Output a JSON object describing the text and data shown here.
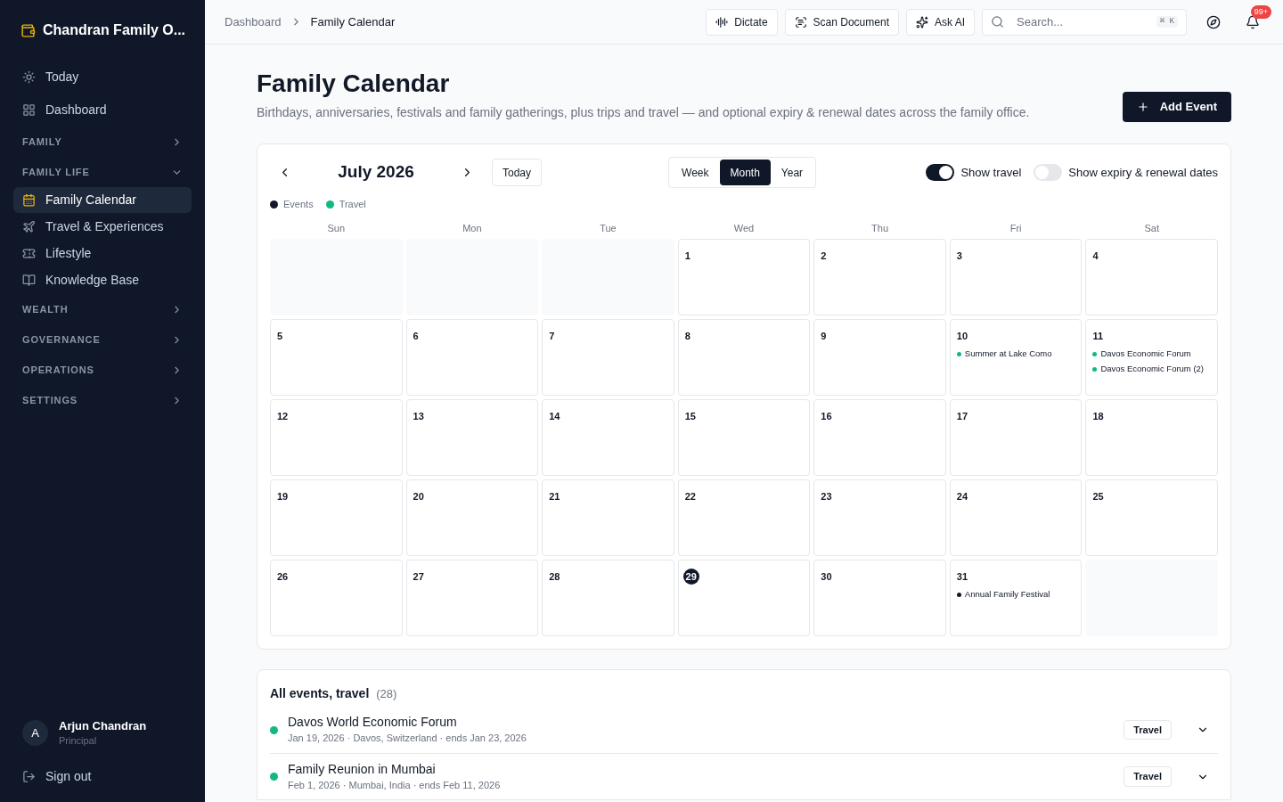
{
  "sidebar": {
    "brand": "Chandran Family O...",
    "items": [
      {
        "kind": "link",
        "label": "Today",
        "selected": false
      },
      {
        "kind": "link",
        "label": "Dashboard",
        "selected": false
      },
      {
        "kind": "section",
        "label": "FAMILY",
        "expanded": false
      },
      {
        "kind": "section",
        "label": "FAMILY LIFE",
        "expanded": true
      },
      {
        "kind": "link",
        "label": "Family Calendar",
        "selected": true
      },
      {
        "kind": "link",
        "label": "Travel & Experiences",
        "selected": false
      },
      {
        "kind": "link",
        "label": "Lifestyle",
        "selected": false
      },
      {
        "kind": "link",
        "label": "Knowledge Base",
        "selected": false
      },
      {
        "kind": "section",
        "label": "WEALTH",
        "expanded": false
      },
      {
        "kind": "section",
        "label": "GOVERNANCE",
        "expanded": false
      },
      {
        "kind": "section",
        "label": "OPERATIONS",
        "expanded": false
      },
      {
        "kind": "section",
        "label": "SETTINGS",
        "expanded": false
      }
    ],
    "user": {
      "initial": "A",
      "name": "Arjun Chandran",
      "role": "Principal"
    },
    "sign_out": "Sign out"
  },
  "topbar": {
    "breadcrumb": [
      "Dashboard",
      "Family Calendar"
    ],
    "buttons": [
      "Dictate",
      "Scan Document",
      "Ask AI"
    ],
    "search": {
      "placeholder": "Search...",
      "shortcut": "⌘ K"
    },
    "notification_badge": "99+"
  },
  "page": {
    "title": "Family Calendar",
    "subtitle": "Birthdays, anniversaries, festivals and family gatherings, plus trips and travel — and optional expiry & renewal dates across the family office.",
    "add_button": "Add Event"
  },
  "calendar": {
    "month": "July 2026",
    "today_button": "Today",
    "views": [
      {
        "label": "Week",
        "selected": false
      },
      {
        "label": "Month",
        "selected": true
      },
      {
        "label": "Year",
        "selected": false
      }
    ],
    "toggles": [
      {
        "label": "Show travel",
        "on": true
      },
      {
        "label": "Show expiry & renewal dates",
        "on": false
      }
    ],
    "legend": [
      {
        "label": "Events",
        "color": "#111827"
      },
      {
        "label": "Travel",
        "color": "#10b981"
      }
    ],
    "weekdays": [
      "Sun",
      "Mon",
      "Tue",
      "Wed",
      "Thu",
      "Fri",
      "Sat"
    ],
    "days": [
      {
        "kind": "blank"
      },
      {
        "kind": "blank"
      },
      {
        "kind": "blank"
      },
      {
        "kind": "day",
        "day": "1",
        "today": false
      },
      {
        "kind": "day",
        "day": "2",
        "today": false
      },
      {
        "kind": "day",
        "day": "3",
        "today": false
      },
      {
        "kind": "day",
        "day": "4",
        "today": false
      },
      {
        "kind": "day",
        "day": "5",
        "today": false
      },
      {
        "kind": "day",
        "day": "6",
        "today": false
      },
      {
        "kind": "day",
        "day": "7",
        "today": false
      },
      {
        "kind": "day",
        "day": "8",
        "today": false
      },
      {
        "kind": "day",
        "day": "9",
        "today": false
      },
      {
        "kind": "day",
        "day": "10",
        "today": false,
        "events": [
          {
            "title": "Summer at Lake Como",
            "color": "#10b981"
          }
        ]
      },
      {
        "kind": "day",
        "day": "11",
        "today": false,
        "events": [
          {
            "title": "Davos Economic Forum",
            "color": "#10b981"
          },
          {
            "title": "Davos Economic Forum (2)",
            "color": "#10b981"
          }
        ]
      },
      {
        "kind": "day",
        "day": "12",
        "today": false
      },
      {
        "kind": "day",
        "day": "13",
        "today": false
      },
      {
        "kind": "day",
        "day": "14",
        "today": false
      },
      {
        "kind": "day",
        "day": "15",
        "today": false
      },
      {
        "kind": "day",
        "day": "16",
        "today": false
      },
      {
        "kind": "day",
        "day": "17",
        "today": false
      },
      {
        "kind": "day",
        "day": "18",
        "today": false
      },
      {
        "kind": "day",
        "day": "19",
        "today": false
      },
      {
        "kind": "day",
        "day": "20",
        "today": false
      },
      {
        "kind": "day",
        "day": "21",
        "today": false
      },
      {
        "kind": "day",
        "day": "22",
        "today": false
      },
      {
        "kind": "day",
        "day": "23",
        "today": false
      },
      {
        "kind": "day",
        "day": "24",
        "today": false
      },
      {
        "kind": "day",
        "day": "25",
        "today": false
      },
      {
        "kind": "day",
        "day": "26",
        "today": false
      },
      {
        "kind": "day",
        "day": "27",
        "today": false
      },
      {
        "kind": "day",
        "day": "28",
        "today": false
      },
      {
        "kind": "day",
        "day": "29",
        "today": true
      },
      {
        "kind": "day",
        "day": "30",
        "today": false
      },
      {
        "kind": "day",
        "day": "31",
        "today": false,
        "events": [
          {
            "title": "Annual Family Festival",
            "color": "#111827"
          }
        ]
      },
      {
        "kind": "blank"
      }
    ]
  },
  "list": {
    "title": "All events, travel",
    "count": "(28)",
    "items": [
      {
        "title": "Davos World Economic Forum",
        "meta": "Jan 19, 2026 · Davos, Switzerland · ends Jan 23, 2026",
        "tag": "Travel",
        "color": "#10b981"
      },
      {
        "title": "Family Reunion in Mumbai",
        "meta": "Feb 1, 2026 · Mumbai, India · ends Feb 11, 2026",
        "tag": "Travel",
        "color": "#10b981"
      }
    ]
  }
}
